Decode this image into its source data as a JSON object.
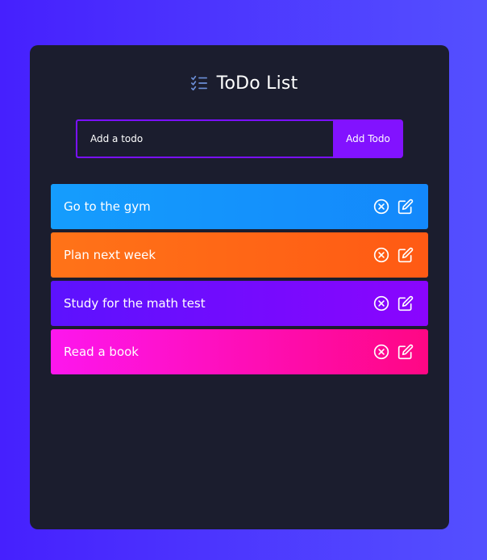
{
  "app": {
    "title": "ToDo List",
    "header_icon": "checklist-icon"
  },
  "form": {
    "placeholder": "Add a todo",
    "value": "",
    "add_label": "Add Todo"
  },
  "todos": [
    {
      "text": "Go to the gym",
      "color": "#159dfd",
      "delete_icon": "circle-x-icon",
      "edit_icon": "edit-icon"
    },
    {
      "text": "Plan next week",
      "color": "#ff6a16",
      "delete_icon": "circle-x-icon",
      "edit_icon": "edit-icon"
    },
    {
      "text": "Study for the math test",
      "color": "#7a0cfe",
      "delete_icon": "circle-x-icon",
      "edit_icon": "edit-icon"
    },
    {
      "text": "Read a book",
      "color": "#fe0fb8",
      "delete_icon": "circle-x-icon",
      "edit_icon": "edit-icon"
    }
  ],
  "colors": {
    "background_start": "#4620fe",
    "background_end": "#5450ff",
    "card": "#1b1d2e",
    "accent": "#8212ff"
  }
}
